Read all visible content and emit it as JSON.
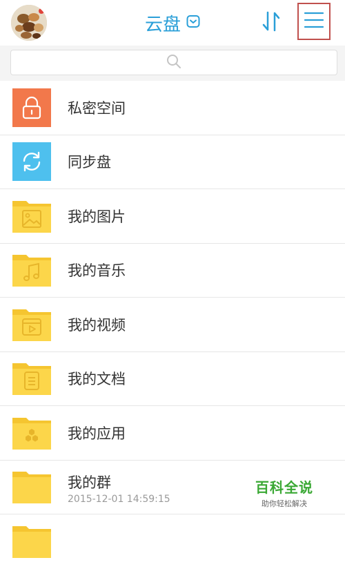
{
  "header": {
    "title": "云盘",
    "title_dropdown_icon": "chevron-down-box-icon",
    "sort_icon": "sort-arrows-icon",
    "menu_icon": "hamburger-menu-icon",
    "accent_color": "#2a9fd8"
  },
  "search": {
    "icon": "search-icon",
    "placeholder": ""
  },
  "items": [
    {
      "label": "私密空间",
      "icon": "lock-icon",
      "color": "#f2784b"
    },
    {
      "label": "同步盘",
      "icon": "sync-icon",
      "color": "#4ec0ee"
    },
    {
      "label": "我的图片",
      "icon": "folder-image-icon",
      "color": "#fcd64a"
    },
    {
      "label": "我的音乐",
      "icon": "folder-music-icon",
      "color": "#fcd64a"
    },
    {
      "label": "我的视频",
      "icon": "folder-video-icon",
      "color": "#fcd64a"
    },
    {
      "label": "我的文档",
      "icon": "folder-document-icon",
      "color": "#fcd64a"
    },
    {
      "label": "我的应用",
      "icon": "folder-apps-icon",
      "color": "#fcd64a"
    },
    {
      "label": "我的群",
      "icon": "folder-icon",
      "color": "#fcd64a",
      "timestamp": "2015-12-01 14:59:15"
    }
  ],
  "watermark": {
    "title": "百科全说",
    "subtitle": "助你轻松解决"
  }
}
